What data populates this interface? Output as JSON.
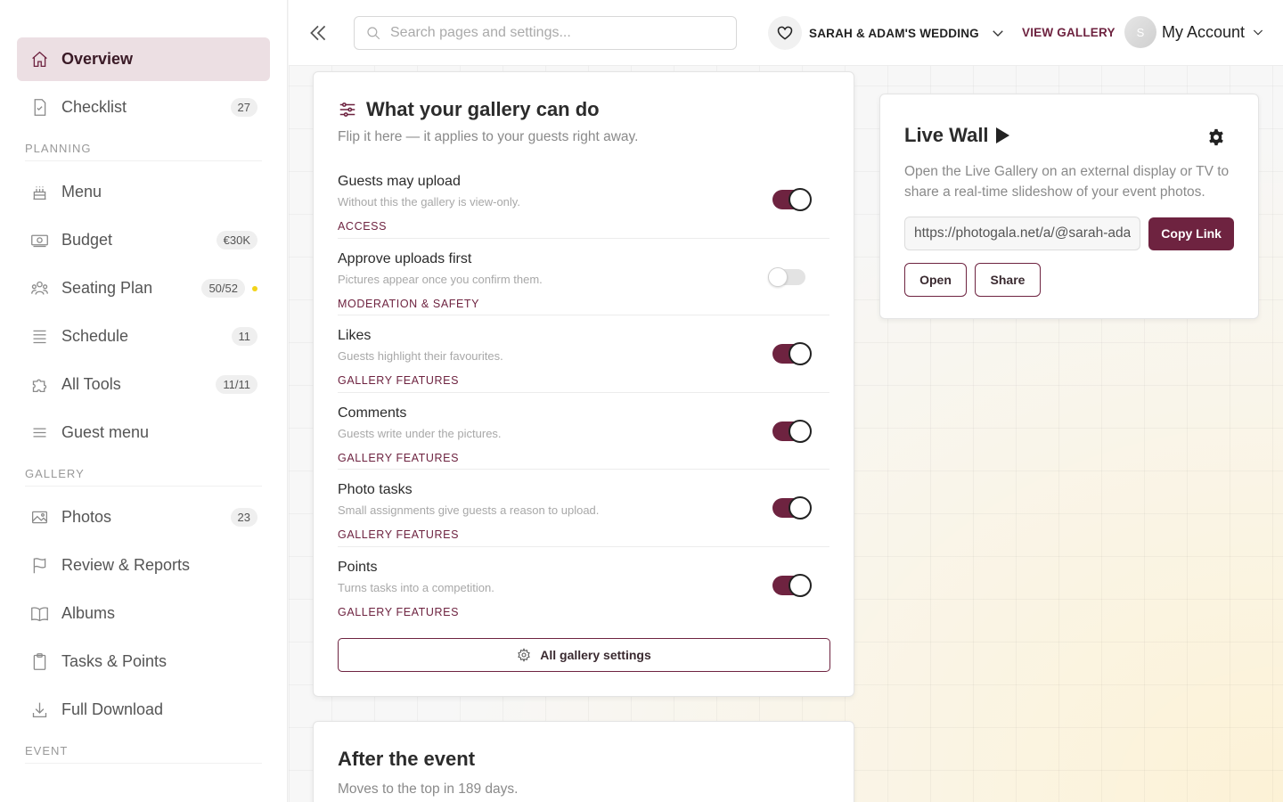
{
  "sidebar": {
    "items_top": [
      {
        "label": "Overview",
        "badge": null
      },
      {
        "label": "Checklist",
        "badge": "27"
      }
    ],
    "planning_head": "PLANNING",
    "planning": [
      {
        "label": "Menu",
        "badge": null
      },
      {
        "label": "Budget",
        "badge": "€30K"
      },
      {
        "label": "Seating Plan",
        "badge": "50/52"
      },
      {
        "label": "Schedule",
        "badge": "11"
      },
      {
        "label": "All Tools",
        "badge": "11/11"
      },
      {
        "label": "Guest menu",
        "badge": null
      }
    ],
    "gallery_head": "GALLERY",
    "gallery": [
      {
        "label": "Photos",
        "badge": "23"
      },
      {
        "label": "Review & Reports",
        "badge": null
      },
      {
        "label": "Albums",
        "badge": null
      },
      {
        "label": "Tasks & Points",
        "badge": null
      },
      {
        "label": "Full Download",
        "badge": null
      }
    ],
    "event_head": "EVENT"
  },
  "topbar": {
    "search_placeholder": "Search pages and settings...",
    "event_name": "SARAH & ADAM'S WEDDING",
    "view_gallery": "VIEW GALLERY",
    "avatar_initial": "S",
    "account_label": "My Account"
  },
  "gallery_card": {
    "title": "What your gallery can do",
    "subtitle": "Flip it here — it applies to your guests right away.",
    "features": [
      {
        "title": "Guests may upload",
        "desc": "Without this the gallery is view-only.",
        "category": "ACCESS",
        "enabled": true
      },
      {
        "title": "Approve uploads first",
        "desc": "Pictures appear once you confirm them.",
        "category": "MODERATION & SAFETY",
        "enabled": false
      },
      {
        "title": "Likes",
        "desc": "Guests highlight their favourites.",
        "category": "GALLERY FEATURES",
        "enabled": true
      },
      {
        "title": "Comments",
        "desc": "Guests write under the pictures.",
        "category": "GALLERY FEATURES",
        "enabled": true
      },
      {
        "title": "Photo tasks",
        "desc": "Small assignments give guests a reason to upload.",
        "category": "GALLERY FEATURES",
        "enabled": true
      },
      {
        "title": "Points",
        "desc": "Turns tasks into a competition.",
        "category": "GALLERY FEATURES",
        "enabled": true
      }
    ],
    "all_settings_label": "All gallery settings"
  },
  "after_card": {
    "title": "After the event",
    "subtitle": "Moves to the top in 189 days."
  },
  "live_wall": {
    "title": "Live Wall",
    "description": "Open the Live Gallery on an external display or TV to share a real-time slideshow of your event photos.",
    "link": "https://photogala.net/a/@sarah-adam",
    "copy_label": "Copy Link",
    "open_label": "Open",
    "share_label": "Share"
  },
  "colors": {
    "accent": "#6e2340",
    "active_bg": "#ecdfe3",
    "dot": "#f2d31a"
  }
}
